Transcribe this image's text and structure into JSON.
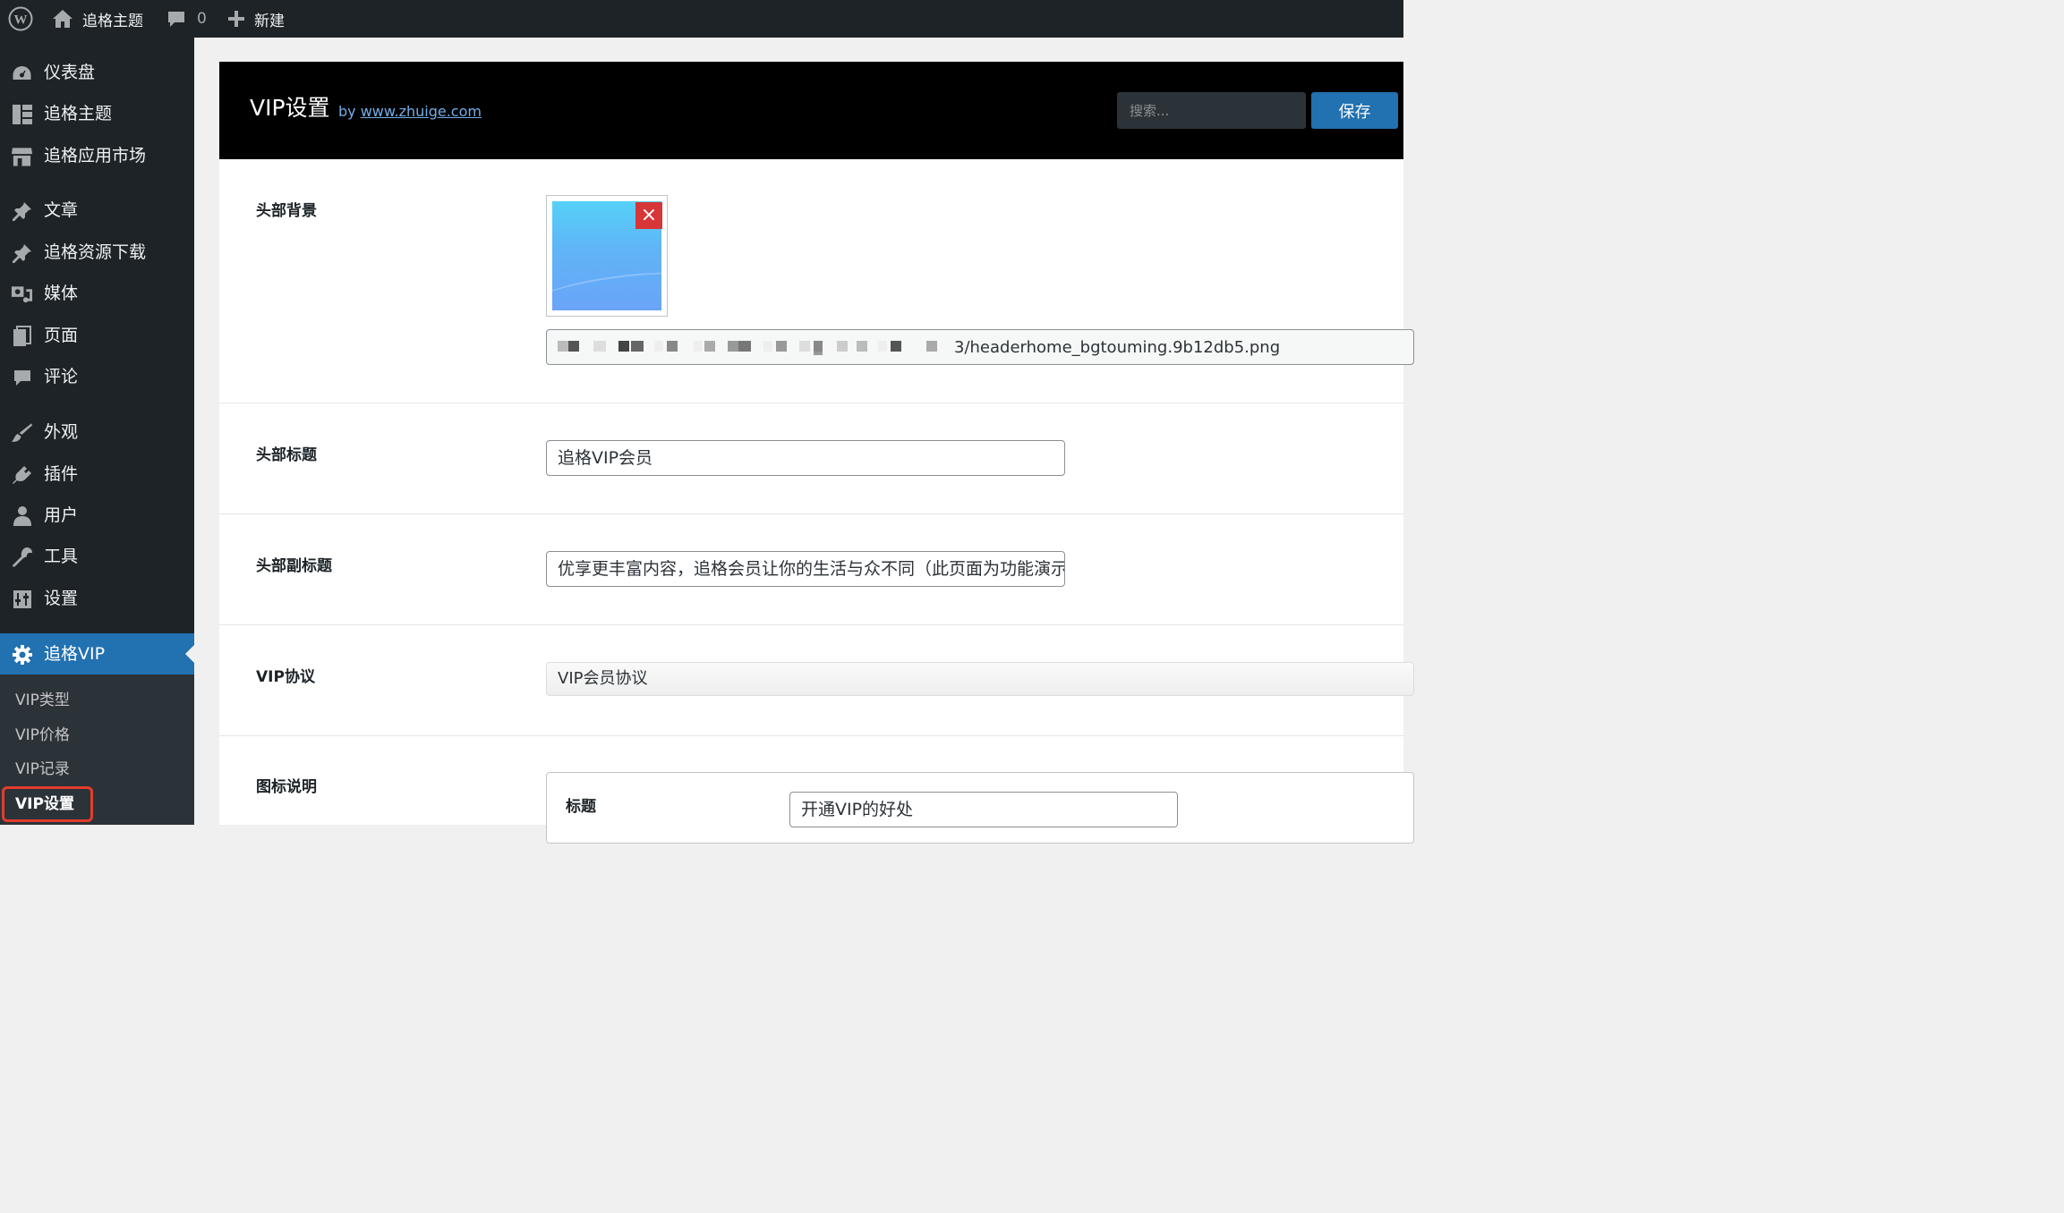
{
  "adminbar": {
    "site_name": "追格主题",
    "comments_count": "0",
    "new_label": "新建"
  },
  "sidebar": {
    "items": [
      {
        "label": "仪表盘",
        "icon": "dashboard-icon"
      },
      {
        "label": "追格主题",
        "icon": "layout-icon"
      },
      {
        "label": "追格应用市场",
        "icon": "store-icon"
      },
      {
        "label": "文章",
        "icon": "pin-icon"
      },
      {
        "label": "追格资源下载",
        "icon": "pin-icon"
      },
      {
        "label": "媒体",
        "icon": "media-icon"
      },
      {
        "label": "页面",
        "icon": "page-icon"
      },
      {
        "label": "评论",
        "icon": "comment-icon"
      },
      {
        "label": "外观",
        "icon": "brush-icon"
      },
      {
        "label": "插件",
        "icon": "plugin-icon"
      },
      {
        "label": "用户",
        "icon": "user-icon"
      },
      {
        "label": "工具",
        "icon": "wrench-icon"
      },
      {
        "label": "设置",
        "icon": "settings-icon"
      },
      {
        "label": "追格VIP",
        "icon": "gear-icon"
      }
    ],
    "submenu": [
      "VIP类型",
      "VIP价格",
      "VIP记录",
      "VIP设置"
    ]
  },
  "panel": {
    "title": "VIP设置",
    "by": "by",
    "link": "www.zhuige.com",
    "search_placeholder": "搜索...",
    "save_label": "保存"
  },
  "fields": {
    "header_bg_label": "头部背景",
    "header_bg_url": "3/headerhome_bgtouming.9b12db5.png",
    "header_title_label": "头部标题",
    "header_title_value": "追格VIP会员",
    "header_subtitle_label": "头部副标题",
    "header_subtitle_value": "优享更丰富内容，追格会员让你的生活与众不同（此页面为功能演示",
    "agreement_label": "VIP协议",
    "agreement_value": "VIP会员协议",
    "icon_desc_label": "图标说明",
    "icon_desc_title_label": "标题",
    "icon_desc_title_value": "开通VIP的好处"
  },
  "colors": {
    "adminbar_bg": "#1d2327",
    "accent": "#2271b1",
    "highlight": "#e23c2c",
    "delete": "#d63638"
  }
}
